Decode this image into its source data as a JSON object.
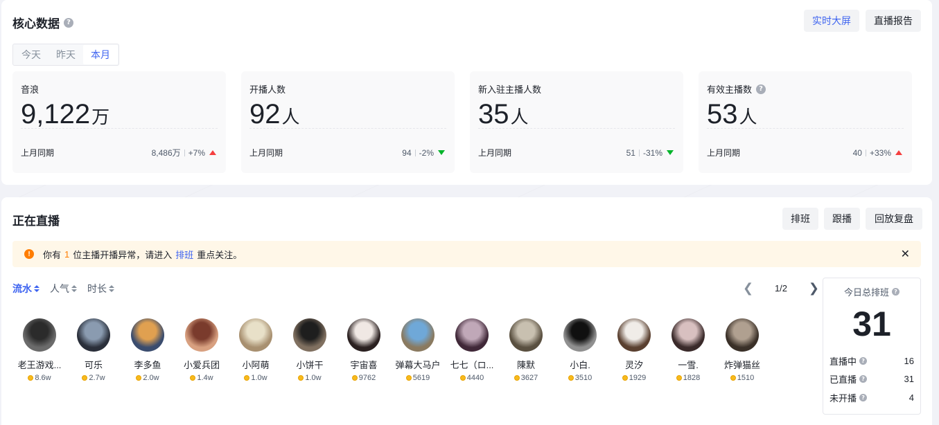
{
  "core": {
    "title": "核心数据",
    "buttons": {
      "realtime": "实时大屏",
      "report": "直播报告"
    },
    "tabs": [
      "今天",
      "昨天",
      "本月"
    ],
    "active_tab": "本月",
    "metrics": [
      {
        "label": "音浪",
        "value": "9,122",
        "unit": "万",
        "foot_label": "上月同期",
        "prev": "8,486万",
        "change": "+7%",
        "trend": "up",
        "help": false
      },
      {
        "label": "开播人数",
        "value": "92",
        "unit": "人",
        "foot_label": "上月同期",
        "prev": "94",
        "change": "-2%",
        "trend": "down",
        "help": false
      },
      {
        "label": "新入驻主播人数",
        "value": "35",
        "unit": "人",
        "foot_label": "上月同期",
        "prev": "51",
        "change": "-31%",
        "trend": "down",
        "help": false
      },
      {
        "label": "有效主播数",
        "value": "53",
        "unit": "人",
        "foot_label": "上月同期",
        "prev": "40",
        "change": "+33%",
        "trend": "up",
        "help": true
      }
    ]
  },
  "live": {
    "title": "正在直播",
    "buttons": {
      "schedule": "排班",
      "follow": "跟播",
      "replay": "回放复盘"
    },
    "alert": {
      "prefix": "你有",
      "count": "1",
      "middle": "位主播开播异常，请进入",
      "link": "排班",
      "suffix": "重点关注。"
    },
    "sorts": [
      {
        "label": "流水",
        "active": true
      },
      {
        "label": "人气",
        "active": false
      },
      {
        "label": "时长",
        "active": false
      }
    ],
    "pager": {
      "text": "1/2"
    },
    "anchors": [
      {
        "name": "老王游戏...",
        "score": "8.6w",
        "c1": "#2b2b2b",
        "c2": "#6b6b6b"
      },
      {
        "name": "可乐",
        "score": "2.7w",
        "c1": "#8a9bb0",
        "c2": "#2a2f3a"
      },
      {
        "name": "李多鱼",
        "score": "2.0w",
        "c1": "#e0a050",
        "c2": "#3a4c6e"
      },
      {
        "name": "小爱兵团",
        "score": "1.4w",
        "c1": "#7a3b2c",
        "c2": "#d8a080"
      },
      {
        "name": "小阿萌",
        "score": "1.0w",
        "c1": "#e8e0c8",
        "c2": "#a89070"
      },
      {
        "name": "小饼干",
        "score": "1.0w",
        "c1": "#1e1e1e",
        "c2": "#807060"
      },
      {
        "name": "宇宙喜",
        "score": "9762",
        "c1": "#f0e8e4",
        "c2": "#2a2020"
      },
      {
        "name": "弹幕大马户",
        "score": "5619",
        "c1": "#6fa8d8",
        "c2": "#8a7a60"
      },
      {
        "name": "七七（ロ...",
        "score": "4440",
        "c1": "#c0a8b8",
        "c2": "#402838"
      },
      {
        "name": "陳默",
        "score": "3627",
        "c1": "#c8c0b0",
        "c2": "#5a5040"
      },
      {
        "name": "小白.",
        "score": "3510",
        "c1": "#101010",
        "c2": "#909090"
      },
      {
        "name": "灵汐",
        "score": "1929",
        "c1": "#f0ece8",
        "c2": "#5a4030"
      },
      {
        "name": "一雪.",
        "score": "1828",
        "c1": "#d8c0c0",
        "c2": "#3a2a2a"
      },
      {
        "name": "炸弹猫丝",
        "score": "1510",
        "c1": "#b0a090",
        "c2": "#3a3028"
      }
    ],
    "ranking": {
      "title": "今日总排班",
      "total": "31",
      "rows": [
        {
          "label": "直播中",
          "value": "16"
        },
        {
          "label": "已直播",
          "value": "31"
        },
        {
          "label": "未开播",
          "value": "4"
        }
      ]
    }
  },
  "colors": {
    "accent": "#3d63f0",
    "up": "#f53f3f",
    "down": "#00b42a",
    "warning": "#ff7d00",
    "alert_bg": "#fff7e8"
  },
  "icons": [
    "help-icon",
    "warning-icon",
    "close-icon",
    "sort-icon",
    "chevron-left-icon",
    "chevron-right-icon",
    "coin-icon"
  ]
}
